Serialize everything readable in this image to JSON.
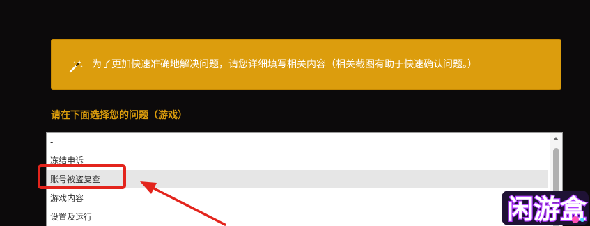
{
  "notice": {
    "icon": "magic-wand-icon",
    "text": "为了更加快速准确地解决问题，请您详细填写相关内容（相关截图有助于快速确认问题。）",
    "background_color": "#dc9d0d"
  },
  "section": {
    "label": "请在下面选择您的问题（游戏）"
  },
  "issue_list": {
    "options": [
      {
        "label": "-"
      },
      {
        "label": "冻结申诉"
      },
      {
        "label": "账号被盗复查"
      },
      {
        "label": "游戏内容"
      },
      {
        "label": "设置及运行"
      }
    ],
    "selected": "账号被盗复查"
  },
  "annotation": {
    "color": "#e3241c"
  },
  "watermark": {
    "text": "闲游盒"
  }
}
